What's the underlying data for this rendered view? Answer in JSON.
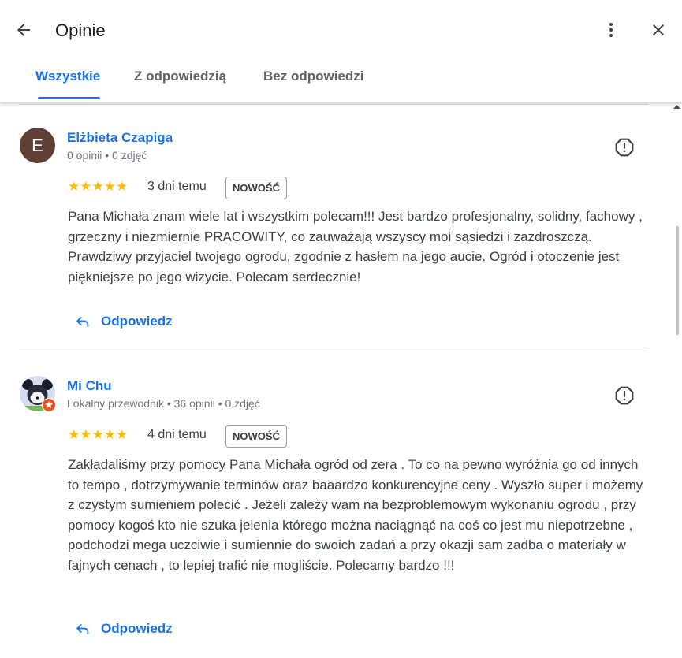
{
  "header": {
    "title": "Opinie",
    "tabs": [
      {
        "label": "Wszystkie",
        "active": true
      },
      {
        "label": "Z odpowiedzią",
        "active": false
      },
      {
        "label": "Bez odpowiedzi",
        "active": false
      }
    ]
  },
  "colors": {
    "accent": "#1a73e8",
    "star": "#fbbc04",
    "avatar_e": "#5d4037"
  },
  "reviews": [
    {
      "avatar_letter": "E",
      "author": "Elżbieta Czapiga",
      "meta": "0 opinii • 0 zdjęć",
      "stars": "★★★★★",
      "rating": 5,
      "date": "3 dni temu",
      "badge": "NOWOŚĆ",
      "text": "Pana Michała znam wiele lat i wszystkim polecam!!! Jest bardzo profesjonalny, solidny, fachowy , grzeczny i niezmiernie PRACOWITY, co zauważają wszyscy moi sąsiedzi i zazdroszczą. Prawdziwy przyjaciel twojego ogrodu, zgodnie z hasłem na jego aucie. Ogród i otoczenie jest piękniejsze po jego wizycie. Polecam serdecznie!",
      "reply_label": "Odpowiedz"
    },
    {
      "author": "Mi Chu",
      "meta": "Lokalny przewodnik • 36 opinii • 0 zdjęć",
      "stars": "★★★★★",
      "rating": 5,
      "date": "4 dni temu",
      "badge": "NOWOŚĆ",
      "text": "Zakładaliśmy przy pomocy Pana Michała ogród od zera . To co na pewno wyróżnia go od innych to tempo , dotrzymywanie terminów oraz baaardzo konkurencyjne ceny . Wyszło super i możemy z czystym sumieniem polecić . Jeżeli zależy wam na bezproblemowym wykonaniu ogrodu , przy pomocy kogoś kto nie szuka jelenia którego można naciągnąć na coś co jest mu niepotrzebne , podchodzi mega uczciwie i sumiennie do swoich zadań a przy okazji sam zadba o materiały w fajnych cenach , to lepiej trafić nie mogliście. Polecamy bardzo !!!",
      "reply_label": "Odpowiedz"
    }
  ],
  "icons": [
    "arrow-back-icon",
    "more-vert-icon",
    "close-icon",
    "report-icon",
    "reply-icon",
    "local-guide-badge-icon"
  ]
}
